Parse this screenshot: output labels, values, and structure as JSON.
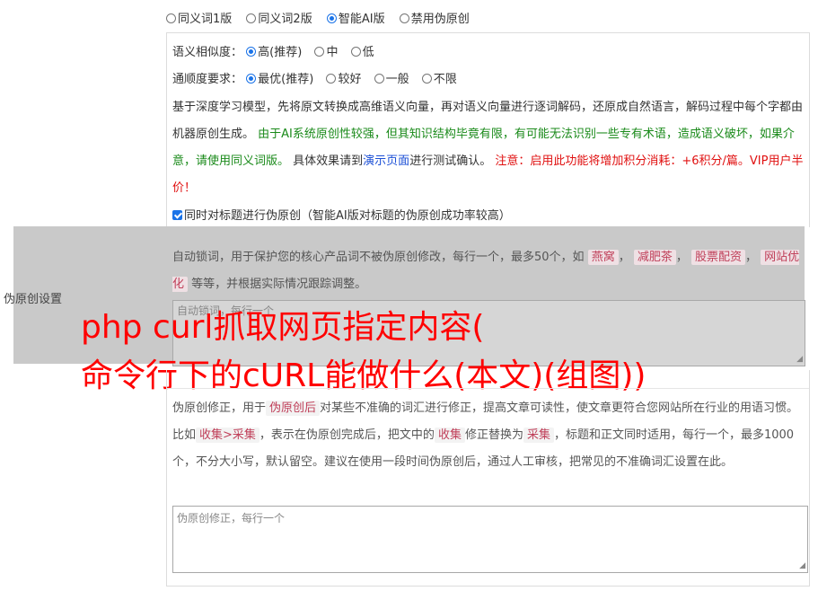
{
  "modes": {
    "options": [
      "同义词1版",
      "同义词2版",
      "智能AI版",
      "禁用伪原创"
    ],
    "selected": "智能AI版"
  },
  "similarity": {
    "label": "语义相似度：",
    "options": [
      "高(推荐)",
      "中",
      "低"
    ],
    "selected": "高(推荐)"
  },
  "fluency": {
    "label": "通顺度要求：",
    "options": [
      "最优(推荐)",
      "较好",
      "一般",
      "不限"
    ],
    "selected": "最优(推荐)"
  },
  "description": {
    "part1": "基于深度学习模型，先将原文转换成高维语义向量，再对语义向量进行逐词解码，还原成自然语言，解码过程中每个字都由机器原创生成。",
    "part2": "由于AI系统原创性较强，但其知识结构毕竟有限，有可能无法识别一些专有术语，造成语义破坏，如果介意，请使用同义词版。",
    "part3": "具体效果请到",
    "link": "演示页面",
    "part4": "进行测试确认。",
    "warning": "注意：启用此功能将增加积分消耗：+6积分/篇。VIP用户半价！"
  },
  "title_checkbox": {
    "label": "同时对标题进行伪原创（智能AI版对标题的伪原创成功率较高）",
    "checked": true
  },
  "side_label": "伪原创设置",
  "lock_words": {
    "desc1": "自动锁词，用于保护您的核心产品词不被伪原创修改，每行一个，最多50个，如",
    "tags": [
      "燕窝",
      "减肥茶",
      "股票配资",
      "网站优化"
    ],
    "desc2": "等等，并根据实际情况跟踪调整。",
    "placeholder": "自动锁词，每行一个"
  },
  "overlay": {
    "line1": "php curl抓取网页指定内容(",
    "line2": "命令行下的cURL能做什么(本文)(组图))"
  },
  "fix_words": {
    "d1": "伪原创修正，用于",
    "tag1": "伪原创后",
    "d2": "对某些不准确的词汇进行修正，提高文章可读性，使文章更符合您网站所在行业的用语习惯。比如",
    "tag2": "收集>采集",
    "d3": "，表示在伪原创完成后，把文中的",
    "tag3": "收集",
    "d4": "修正替换为",
    "tag4": "采集",
    "d5": "，标题和正文同时适用，每行一个，最多1000个，不分大小写，默认留空。建议在使用一段时间伪原创后，通过人工审核，把常见的不准确词汇设置在此。",
    "placeholder": "伪原创修正，每行一个"
  }
}
